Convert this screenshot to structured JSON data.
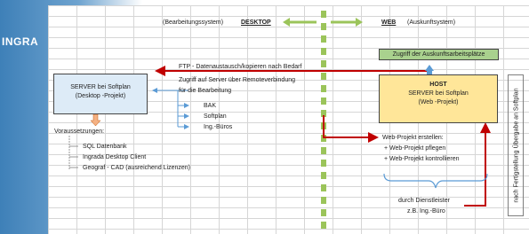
{
  "logo": "INGRA",
  "header": {
    "left_note": "(Bearbeitungssystem)",
    "left_title": "DESKTOP",
    "right_title": "WEB",
    "right_note": "(Auskunftsystem)"
  },
  "server_box": {
    "line1": "SERVER bei Softplan",
    "line2": "(Desktop -Projekt)"
  },
  "host_box": {
    "title": "HOST",
    "line2": "SERVER bei Softplan",
    "line3": "(Web -Projekt)"
  },
  "access_box": "Zugriff der Auskunftsarbeitsplätze",
  "ftp_label": "FTP - Datenaustausch/kopieren nach Bedarf",
  "remote_access": {
    "line1": "Zugriff auf Server über Remoteverbindung",
    "line2": "für die Bearbeitung",
    "items": [
      "BAK",
      "Softplan",
      "Ing.-Büros"
    ]
  },
  "prerequisites": {
    "title": "Voraussetzungen:",
    "items": [
      "SQL Datenbank",
      "Ingrada Desktop Client",
      "Geograf - CAD (ausreichend Lizenzen)"
    ]
  },
  "web_project": {
    "title": "Web-Projekt erstellen:",
    "items": [
      "+   Web-Projekt pflegen",
      "+   Web-Projekt kontrollieren"
    ]
  },
  "provider": {
    "line1": "durch Dienstleister",
    "line2": "z.B. Ing.-Büro"
  },
  "vertical_note": "nach Fertigstellung Übergabe an Softplan",
  "colors": {
    "green_dash": "#9bc45a",
    "red_arrow": "#c00000",
    "blue_arrow": "#5b9bd5",
    "host_fill": "#ffe699",
    "access_fill": "#a9d18e",
    "orange_arrow": "#f4b183"
  }
}
